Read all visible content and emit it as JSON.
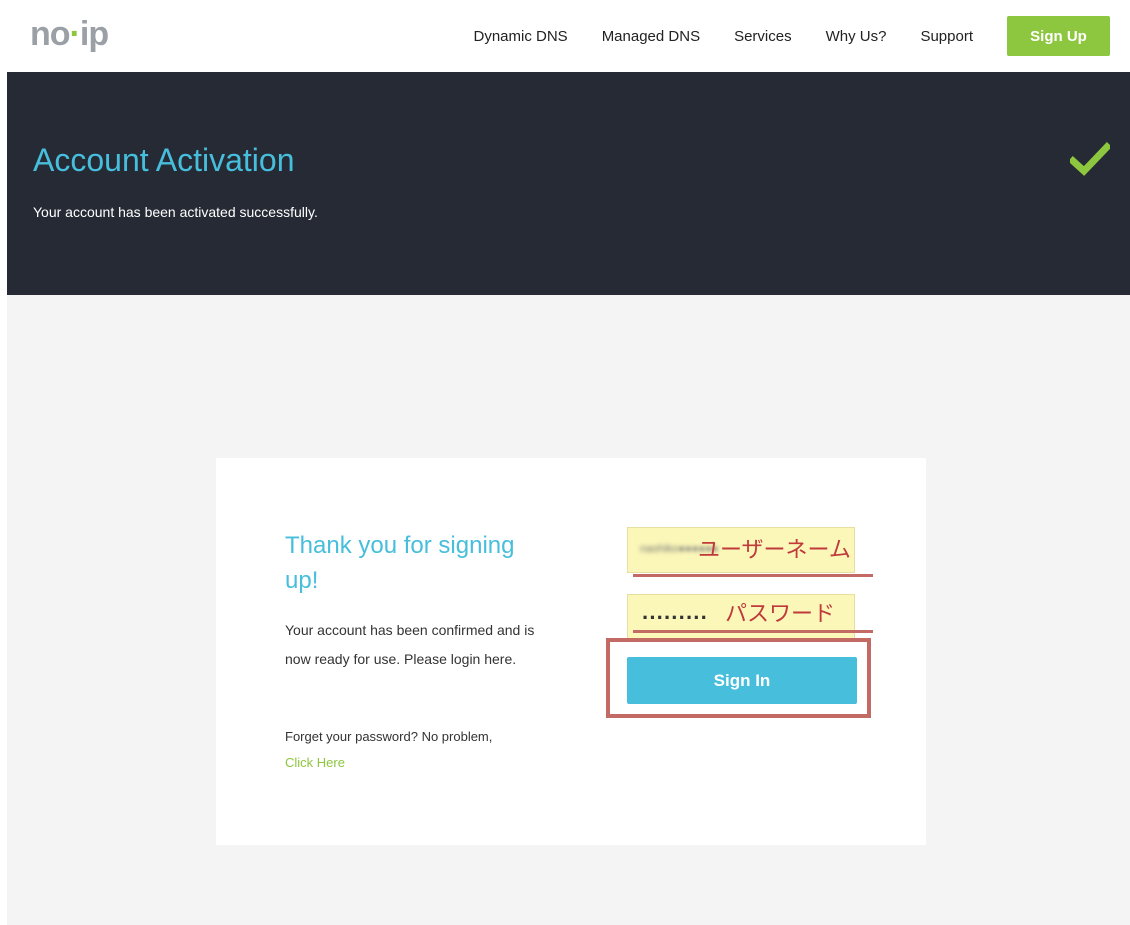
{
  "header": {
    "logo": {
      "prefix": "no",
      "dot": "·",
      "suffix": "ip"
    },
    "nav": [
      "Dynamic DNS",
      "Managed DNS",
      "Services",
      "Why Us?",
      "Support"
    ],
    "signup_label": "Sign Up"
  },
  "hero": {
    "title": "Account Activation",
    "subtitle": "Your account has been activated successfully.",
    "status_icon": "check-icon"
  },
  "card": {
    "title": "Thank you for signing up!",
    "body": "Your account has been confirmed and is now ready for use. Please login here.",
    "forgot_text": "Forget your password? No problem,",
    "forgot_link": "Click Here",
    "username_value": "naohiko●●●●●●",
    "password_value": "·········",
    "signin_label": "Sign In",
    "annotation_username": "ユーザーネーム",
    "annotation_password": "パスワード"
  },
  "colors": {
    "accent": "#46bedc",
    "brand_green": "#8dc63f",
    "hero_bg": "#252a35",
    "annotation": "#c0393b"
  }
}
